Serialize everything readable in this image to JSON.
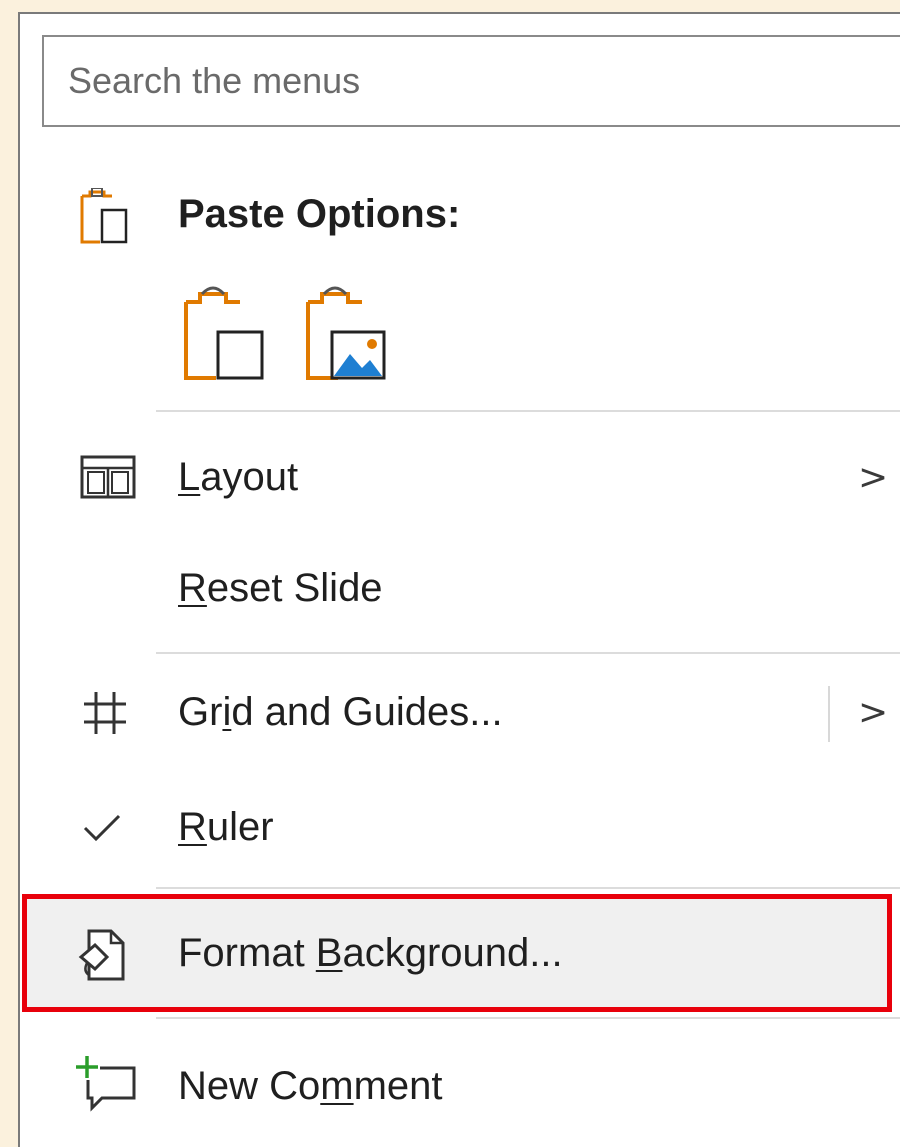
{
  "search": {
    "placeholder": "Search the menus"
  },
  "menu": {
    "paste_options": {
      "label": "Paste Options:"
    },
    "layout": {
      "prefix": "",
      "accel": "L",
      "suffix": "ayout",
      "submenu": true
    },
    "reset_slide": {
      "prefix": "",
      "accel": "R",
      "suffix": "eset Slide"
    },
    "grid_and_guides": {
      "prefix": "Gr",
      "accel": "i",
      "suffix": "d and Guides...",
      "submenu": true
    },
    "ruler": {
      "prefix": "",
      "accel": "R",
      "suffix": "uler",
      "checked": true
    },
    "format_background": {
      "prefix": "Format ",
      "accel": "B",
      "suffix": "ackground...",
      "highlighted": true
    },
    "new_comment": {
      "prefix": "New Co",
      "accel": "m",
      "suffix": "ment"
    }
  },
  "icons": {
    "paste_options": "clipboard-icon",
    "paste_keep_source": "clipboard-paste-icon",
    "paste_picture": "clipboard-picture-icon",
    "layout": "layout-icon",
    "grid": "grid-icon",
    "check": "check-icon",
    "format_background": "format-background-icon",
    "new_comment": "new-comment-icon",
    "chevron": "chevron-right-icon"
  },
  "colors": {
    "page_background": "#fbf1dd",
    "highlight_border": "#e8000b",
    "clipboard_orange": "#e07a00",
    "picture_blue": "#1e7fd2",
    "comment_plus_green": "#2a9d2a"
  }
}
